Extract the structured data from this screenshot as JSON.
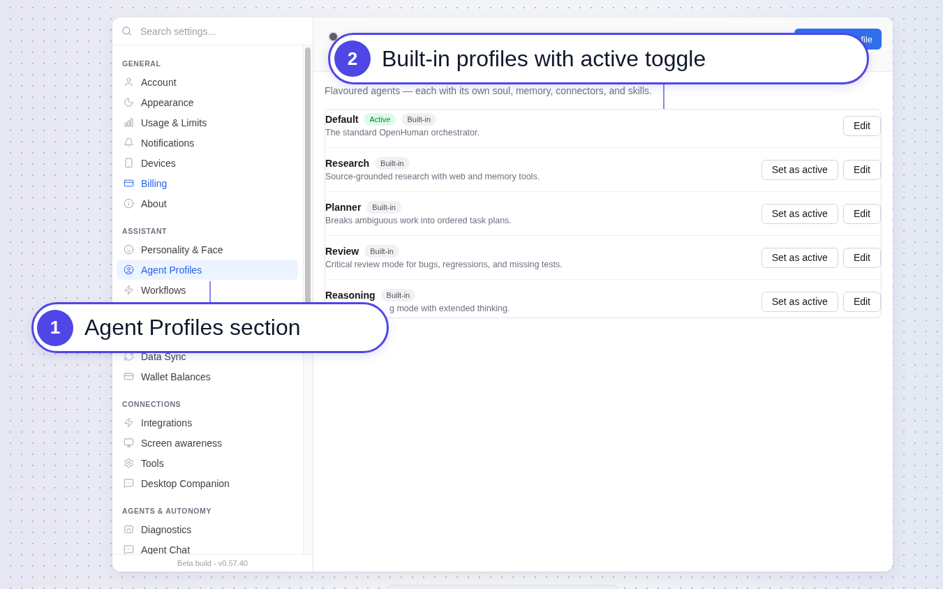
{
  "sidebar": {
    "search": {
      "placeholder": "Search settings..."
    },
    "sections": [
      {
        "heading": "GENERAL",
        "items": [
          {
            "label": "Account",
            "selected": false,
            "accent": false
          },
          {
            "label": "Appearance",
            "selected": false,
            "accent": false
          },
          {
            "label": "Usage & Limits",
            "selected": false,
            "accent": false
          },
          {
            "label": "Notifications",
            "selected": false,
            "accent": false
          },
          {
            "label": "Devices",
            "selected": false,
            "accent": false
          },
          {
            "label": "Billing",
            "selected": false,
            "accent": true
          },
          {
            "label": "About",
            "selected": false,
            "accent": false
          }
        ]
      },
      {
        "heading": "ASSISTANT",
        "items": [
          {
            "label": "Personality & Face",
            "selected": false,
            "accent": false
          },
          {
            "label": "Agent Profiles",
            "selected": true,
            "accent": false
          },
          {
            "label": "Workflows",
            "selected": false,
            "accent": false
          }
        ]
      },
      {
        "items": [
          {
            "label": "Data Sync",
            "selected": false,
            "accent": false
          },
          {
            "label": "Wallet Balances",
            "selected": false,
            "accent": false
          }
        ]
      },
      {
        "heading": "CONNECTIONS",
        "items": [
          {
            "label": "Integrations",
            "selected": false,
            "accent": false
          },
          {
            "label": "Screen awareness",
            "selected": false,
            "accent": false
          },
          {
            "label": "Tools",
            "selected": false,
            "accent": false
          },
          {
            "label": "Desktop Companion",
            "selected": false,
            "accent": false
          }
        ]
      },
      {
        "heading": "AGENTS & AUTONOMY",
        "items": [
          {
            "label": "Diagnostics",
            "selected": false,
            "accent": false
          },
          {
            "label": "Agent Chat",
            "selected": false,
            "accent": false
          }
        ]
      }
    ],
    "footer": "Beta build - v0.57.40"
  },
  "header": {
    "button": "file"
  },
  "profiles": {
    "subtitle": "Flavoured agents — each with its own soul, memory, connectors, and skills.",
    "active_label": "Active",
    "items": [
      {
        "name": "Default",
        "active": true,
        "tag": "Built-in",
        "description": "The standard OpenHuman orchestrator.",
        "partly_hidden": false,
        "edit_button": "Edit"
      },
      {
        "name": "Research",
        "active": false,
        "tag": "Built-in",
        "description": "Source-grounded research with web and memory tools.",
        "partly_hidden": false,
        "set_active_button": "Set as active",
        "edit_button": "Edit"
      },
      {
        "name": "Planner",
        "active": false,
        "tag": "Built-in",
        "description": "Breaks ambiguous work into ordered task plans.",
        "partly_hidden": false,
        "set_active_button": "Set as active",
        "edit_button": "Edit"
      },
      {
        "name": "Review",
        "active": false,
        "tag": "Built-in",
        "description": "Critical review mode for bugs, regressions, and missing tests.",
        "partly_hidden": false,
        "set_active_button": "Set as active",
        "edit_button": "Edit"
      },
      {
        "name": "Reasoning",
        "active": false,
        "tag": "Built-in",
        "description": "g mode with extended thinking.",
        "partly_hidden": true,
        "set_active_button": "Set as active",
        "edit_button": "Edit"
      }
    ]
  },
  "callouts": [
    {
      "number": "1",
      "text": "Agent Profiles section"
    },
    {
      "number": "2",
      "text": "Built-in profiles with active toggle"
    }
  ]
}
